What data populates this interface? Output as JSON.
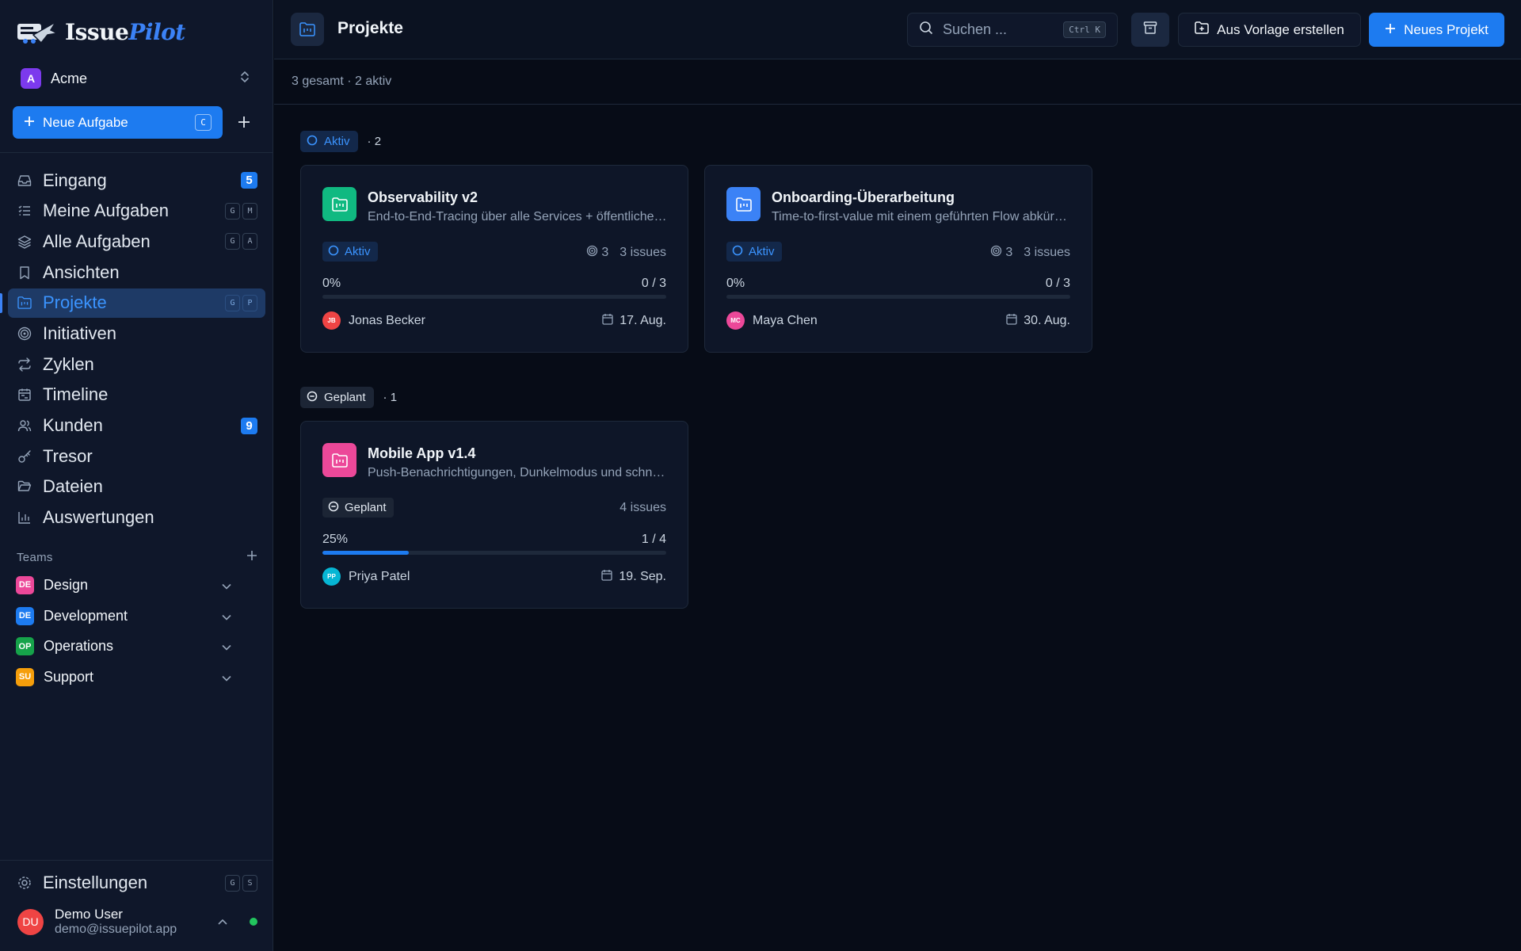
{
  "app": {
    "logo_main": "Issue",
    "logo_accent": "Pilot"
  },
  "workspace": {
    "initial": "A",
    "name": "Acme"
  },
  "new_task": {
    "label": "Neue Aufgabe",
    "shortcut": "C"
  },
  "nav": [
    {
      "label": "Eingang",
      "icon": "inbox-icon",
      "badge": "5"
    },
    {
      "label": "Meine Aufgaben",
      "icon": "list-icon",
      "keys": [
        "G",
        "M"
      ]
    },
    {
      "label": "Alle Aufgaben",
      "icon": "layers-icon",
      "keys": [
        "G",
        "A"
      ]
    },
    {
      "label": "Ansichten",
      "icon": "bookmark-icon"
    },
    {
      "label": "Projekte",
      "icon": "folder-kanban-icon",
      "keys": [
        "G",
        "P"
      ],
      "active": true
    },
    {
      "label": "Initiativen",
      "icon": "target-icon"
    },
    {
      "label": "Zyklen",
      "icon": "repeat-icon"
    },
    {
      "label": "Timeline",
      "icon": "calendar-range-icon"
    },
    {
      "label": "Kunden",
      "icon": "users-icon",
      "badge": "9"
    },
    {
      "label": "Tresor",
      "icon": "key-icon"
    },
    {
      "label": "Dateien",
      "icon": "folder-open-icon"
    },
    {
      "label": "Auswertungen",
      "icon": "bar-chart-icon"
    }
  ],
  "teams": {
    "heading": "Teams",
    "items": [
      {
        "abbr": "DE",
        "name": "Design",
        "color": "#ec4899"
      },
      {
        "abbr": "DE",
        "name": "Development",
        "color": "#1d7bf0"
      },
      {
        "abbr": "OP",
        "name": "Operations",
        "color": "#16a34a"
      },
      {
        "abbr": "SU",
        "name": "Support",
        "color": "#f59e0b"
      }
    ]
  },
  "settings": {
    "label": "Einstellungen",
    "keys": [
      "G",
      "S"
    ]
  },
  "user": {
    "initials": "DU",
    "name": "Demo User",
    "email": "demo@issuepilot.app"
  },
  "header": {
    "title": "Projekte",
    "search_placeholder": "Suchen ...",
    "search_shortcut": "Ctrl K",
    "template_button": "Aus Vorlage erstellen",
    "new_project_button": "Neues Projekt"
  },
  "summary": "3 gesamt · 2 aktiv",
  "groups": [
    {
      "status": "Aktiv",
      "count": "2",
      "projects": [
        {
          "title": "Observability v2",
          "description": "End-to-End-Tracing über alle Services + öffentliche Statusseite",
          "status": "Aktiv",
          "initiatives": "3",
          "issues": "3 issues",
          "percent_label": "0%",
          "progress": 0,
          "fraction": "0 / 3",
          "lead_initials": "JB",
          "lead_name": "Jonas Becker",
          "lead_color": "#ef4444",
          "date": "17. Aug.",
          "icon_color": "#10b981"
        },
        {
          "title": "Onboarding-Überarbeitung",
          "description": "Time-to-first-value mit einem geführten Flow abkürzen",
          "status": "Aktiv",
          "initiatives": "3",
          "issues": "3 issues",
          "percent_label": "0%",
          "progress": 0,
          "fraction": "0 / 3",
          "lead_initials": "MC",
          "lead_name": "Maya Chen",
          "lead_color": "#ec4899",
          "date": "30. Aug.",
          "icon_color": "#3b82f6"
        }
      ]
    },
    {
      "status": "Geplant",
      "count": "1",
      "projects": [
        {
          "title": "Mobile App v1.4",
          "description": "Push-Benachrichtigungen, Dunkelmodus und schnellere Startzeit",
          "status": "Geplant",
          "issues": "4 issues",
          "percent_label": "25%",
          "progress": 0.25,
          "fraction": "1 / 4",
          "lead_initials": "PP",
          "lead_name": "Priya Patel",
          "lead_color": "#06b6d4",
          "date": "19. Sep.",
          "icon_color": "#ec4899"
        }
      ]
    }
  ]
}
